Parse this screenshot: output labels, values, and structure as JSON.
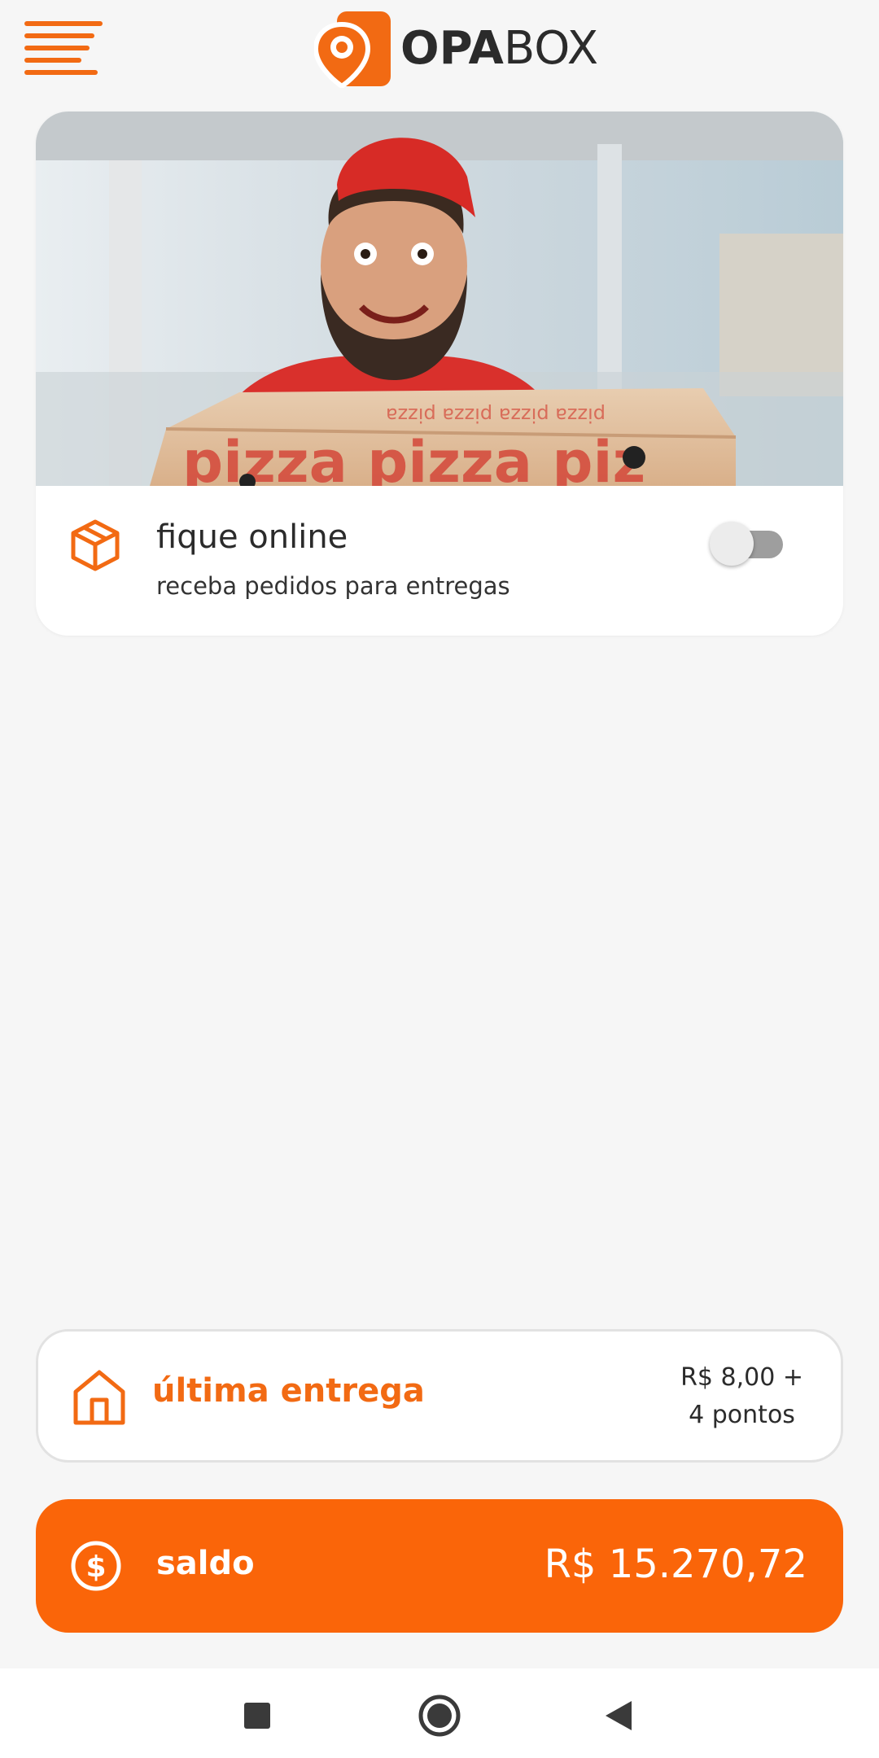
{
  "brand": {
    "name_bold": "OPA",
    "name_light": "BOX",
    "accent": "#f26a13",
    "cta": "#fa6509"
  },
  "header": {
    "menu_icon": "hamburger-menu-icon"
  },
  "hero": {
    "image": "delivery-man-holding-pizza-box",
    "toggle": {
      "title": "fique online",
      "subtitle": "receba pedidos para entregas",
      "icon": "package-icon",
      "state": "off"
    }
  },
  "last_delivery": {
    "label": "última entrega",
    "icon": "house-icon",
    "value_line1": "R$ 8,00 +",
    "value_line2": "4 pontos"
  },
  "balance": {
    "label": "saldo",
    "icon": "dollar-icon",
    "amount": "R$ 15.270,72"
  },
  "navbar": {
    "items": [
      "recent-apps-icon",
      "home-icon",
      "back-icon"
    ]
  }
}
